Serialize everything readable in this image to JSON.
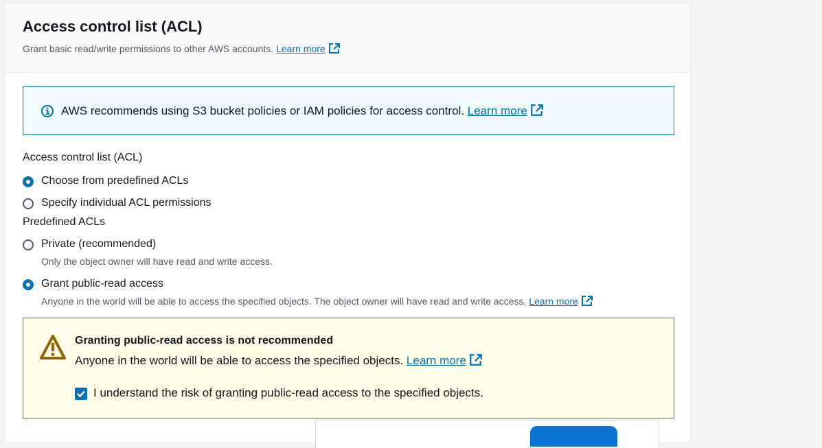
{
  "header": {
    "title": "Access control list (ACL)",
    "subtitle": "Grant basic read/write permissions to other AWS accounts.",
    "learn_more": "Learn more"
  },
  "info_alert": {
    "text": "AWS recommends using S3 bucket policies or IAM policies for access control.",
    "learn_more": "Learn more",
    "icon": "info-icon"
  },
  "acl_group": {
    "label": "Access control list (ACL)",
    "options": [
      {
        "label": "Choose from predefined ACLs",
        "selected": true
      },
      {
        "label": "Specify individual ACL permissions",
        "selected": false
      }
    ]
  },
  "predefined_group": {
    "label": "Predefined ACLs",
    "options": [
      {
        "label": "Private (recommended)",
        "description": "Only the object owner will have read and write access.",
        "selected": false
      },
      {
        "label": "Grant public-read access",
        "description": "Anyone in the world will be able to access the specified objects. The object owner will have read and write access.",
        "learn_more": "Learn more",
        "selected": true
      }
    ]
  },
  "warning": {
    "icon": "warning-icon",
    "title": "Granting public-read access is not recommended",
    "text": "Anyone in the world will be able to access the specified objects.",
    "learn_more": "Learn more",
    "checkbox_label": "I understand the risk of granting public-read access to the specified objects.",
    "checkbox_checked": true
  },
  "colors": {
    "link": "#0073bb",
    "info_bg": "#f1faff",
    "warning_bg": "#fffce7",
    "warning_border": "#8d6605",
    "primary": "#0073bb"
  }
}
